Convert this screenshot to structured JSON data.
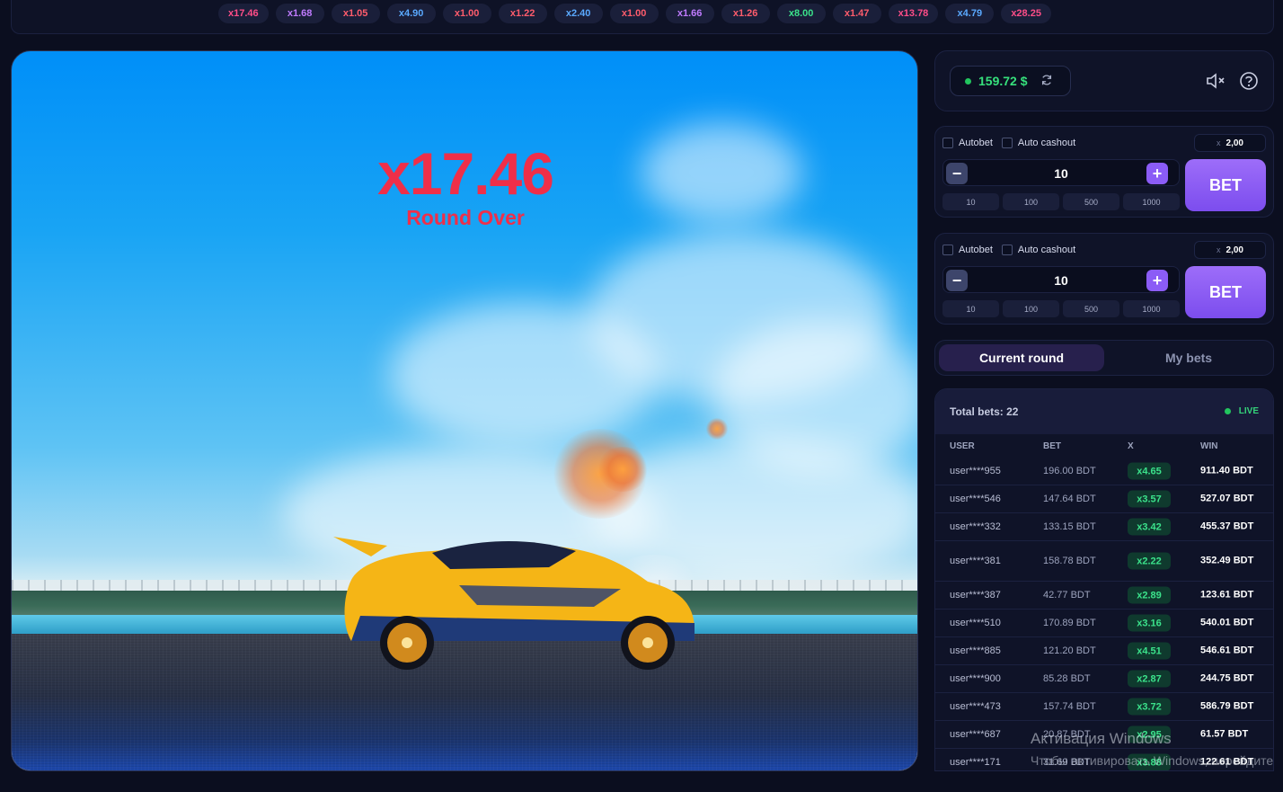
{
  "history": [
    {
      "label": "x17.46",
      "color": "#ff4d88"
    },
    {
      "label": "x1.68",
      "color": "#c07bff"
    },
    {
      "label": "x1.05",
      "color": "#ff5c6c"
    },
    {
      "label": "x4.90",
      "color": "#5aa9ff"
    },
    {
      "label": "x1.00",
      "color": "#ff5c6c"
    },
    {
      "label": "x1.22",
      "color": "#ff5c6c"
    },
    {
      "label": "x2.40",
      "color": "#5aa9ff"
    },
    {
      "label": "x1.00",
      "color": "#ff5c6c"
    },
    {
      "label": "x1.66",
      "color": "#c07bff"
    },
    {
      "label": "x1.26",
      "color": "#ff5c6c"
    },
    {
      "label": "x8.00",
      "color": "#3be28b"
    },
    {
      "label": "x1.47",
      "color": "#ff5c6c"
    },
    {
      "label": "x13.78",
      "color": "#ff4d88"
    },
    {
      "label": "x4.79",
      "color": "#5aa9ff"
    },
    {
      "label": "x28.25",
      "color": "#ff4d88"
    }
  ],
  "game": {
    "multiplier": "x17.46",
    "status": "Round Over"
  },
  "wallet": {
    "balance": "159.72 $"
  },
  "bet_panels": [
    {
      "autobet_label": "Autobet",
      "auto_cashout_label": "Auto cashout",
      "cashout_prefix": "x",
      "cashout_value": "2,00",
      "amount": "10",
      "minus_symbol": "−",
      "plus_symbol": "+",
      "presets": [
        "10",
        "100",
        "500",
        "1000"
      ],
      "bet_label": "BET"
    },
    {
      "autobet_label": "Autobet",
      "auto_cashout_label": "Auto cashout",
      "cashout_prefix": "x",
      "cashout_value": "2,00",
      "amount": "10",
      "minus_symbol": "−",
      "plus_symbol": "+",
      "presets": [
        "10",
        "100",
        "500",
        "1000"
      ],
      "bet_label": "BET"
    }
  ],
  "tabs": {
    "current": "Current round",
    "mine": "My bets"
  },
  "bets": {
    "total": "Total bets: 22",
    "live_label": "LIVE",
    "columns": {
      "user": "USER",
      "bet": "BET",
      "x": "X",
      "win": "WIN"
    },
    "rows": [
      {
        "user": "user****955",
        "bet": "196.00 BDT",
        "x": "x4.65",
        "win": "911.40 BDT"
      },
      {
        "user": "user****546",
        "bet": "147.64 BDT",
        "x": "x3.57",
        "win": "527.07 BDT"
      },
      {
        "user": "user****332",
        "bet": "133.15 BDT",
        "x": "x3.42",
        "win": "455.37 BDT"
      },
      {
        "user": "user****381",
        "bet": "158.78 BDT",
        "x": "x2.22",
        "win": "352.49 BDT"
      },
      {
        "user": "user****387",
        "bet": "42.77 BDT",
        "x": "x2.89",
        "win": "123.61 BDT"
      },
      {
        "user": "user****510",
        "bet": "170.89 BDT",
        "x": "x3.16",
        "win": "540.01 BDT"
      },
      {
        "user": "user****885",
        "bet": "121.20 BDT",
        "x": "x4.51",
        "win": "546.61 BDT"
      },
      {
        "user": "user****900",
        "bet": "85.28 BDT",
        "x": "x2.87",
        "win": "244.75 BDT"
      },
      {
        "user": "user****473",
        "bet": "157.74 BDT",
        "x": "x3.72",
        "win": "586.79 BDT"
      },
      {
        "user": "user****687",
        "bet": "20.87 BDT",
        "x": "x2.95",
        "win": "61.57 BDT"
      },
      {
        "user": "user****171",
        "bet": "31.69 BDT",
        "x": "x3.88",
        "win": "122.61 BDT"
      }
    ]
  },
  "watermark": {
    "title": "Активация Windows",
    "subtitle": "Чтобы активировать Windows, перейдите"
  }
}
